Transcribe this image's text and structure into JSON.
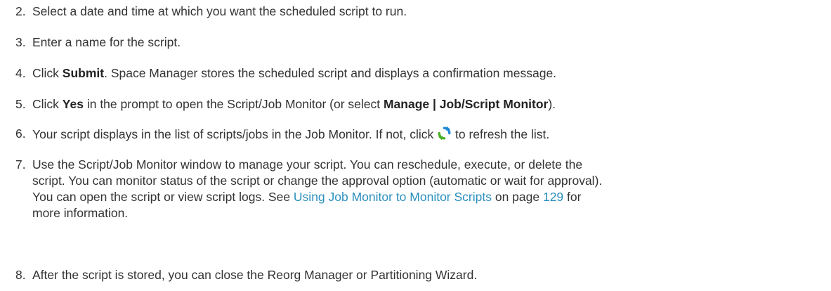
{
  "steps": [
    {
      "num": "2.",
      "text": "Select a date and time at which you want the scheduled script to run."
    },
    {
      "num": "3.",
      "text": "Enter a name for the script."
    },
    {
      "num": "4.",
      "pre": "Click ",
      "bold": "Submit",
      "post": ". Space Manager stores the scheduled script and displays a confirmation message."
    },
    {
      "num": "5.",
      "pre": "Click ",
      "bold1": "Yes",
      "mid": " in the prompt to open the Script/Job Monitor (or select ",
      "bold2": "Manage | Job/Script Monitor",
      "post": ")."
    },
    {
      "num": "6.",
      "pre": "Your script displays in the list of scripts/jobs in the Job Monitor. If not, click ",
      "icon": "refresh-icon",
      "post": " to refresh the list."
    },
    {
      "num": "7.",
      "l1": "Use the Script/Job Monitor window to manage your script. You can reschedule, execute, or delete the",
      "l2": "script. You can monitor status of the script or change the approval option (automatic or wait for approval).",
      "l3": "You can open the script or view script logs. See ",
      "link": "Using Job Monitor to Monitor Scripts",
      "on": " on page ",
      "page": "129",
      "l3post": " for",
      "l4": "more information."
    },
    {
      "num": "8.",
      "text": "After the script is stored, you can close the Reorg Manager or Partitioning Wizard."
    }
  ],
  "colors": {
    "text": "#333333",
    "link": "#2b8fbd",
    "icon_blue": "#1e88d4",
    "icon_green": "#4caf28"
  }
}
